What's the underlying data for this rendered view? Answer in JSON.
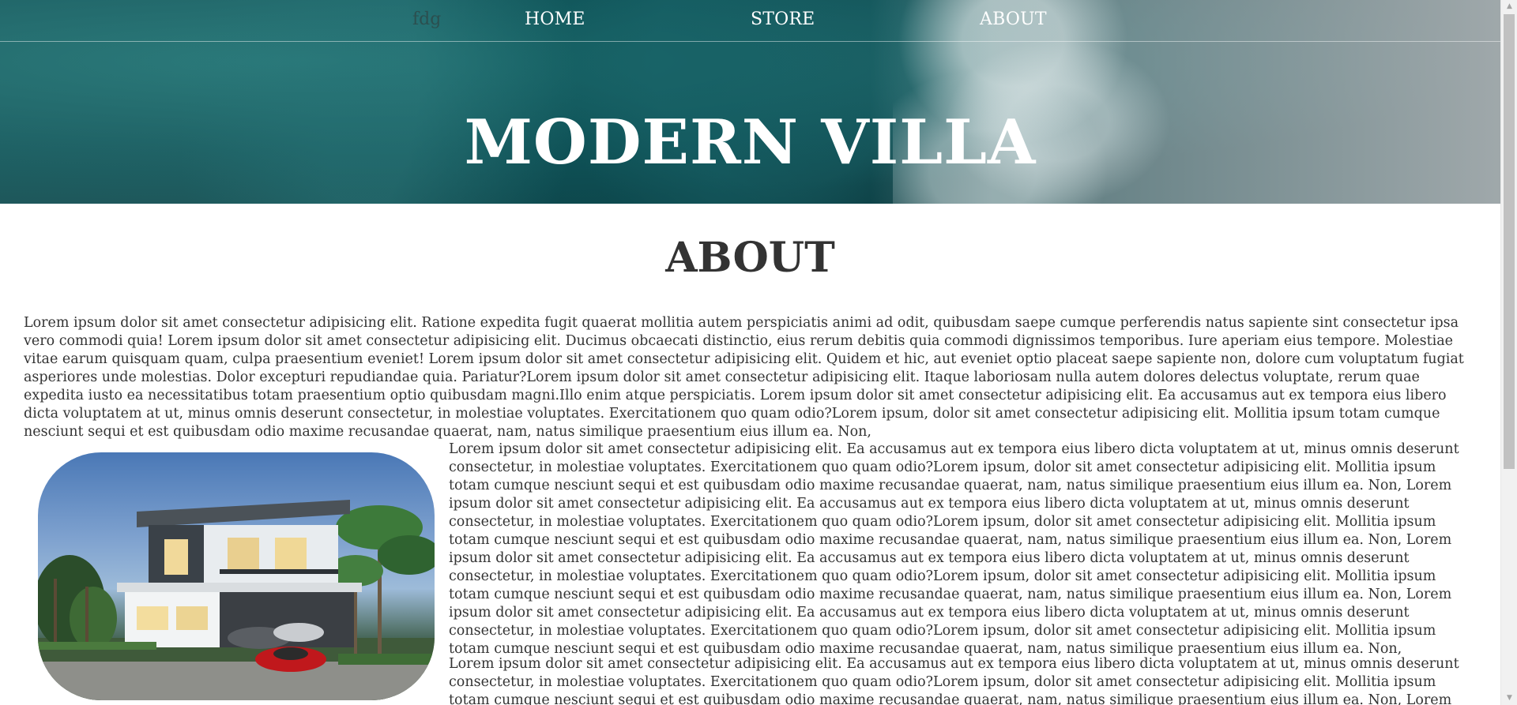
{
  "nav": {
    "brand": "fdg",
    "items": [
      {
        "label": "HOME"
      },
      {
        "label": "STORE"
      },
      {
        "label": "ABOUT"
      }
    ]
  },
  "hero": {
    "title": "MODERN VILLA"
  },
  "about": {
    "heading": "ABOUT",
    "paragraph1": "Lorem ipsum dolor sit amet consectetur adipisicing elit. Ratione expedita fugit quaerat mollitia autem perspiciatis animi ad odit, quibusdam saepe cumque perferendis natus sapiente sint consectetur ipsa vero commodi quia! Lorem ipsum dolor sit amet consectetur adipisicing elit. Ducimus obcaecati distinctio, eius rerum debitis quia commodi dignissimos temporibus. Iure aperiam eius tempore. Molestiae vitae earum quisquam quam, culpa praesentium eveniet! Lorem ipsum dolor sit amet consectetur adipisicing elit. Quidem et hic, aut eveniet optio placeat saepe sapiente non, dolore cum voluptatum fugiat asperiores unde molestias. Dolor excepturi repudiandae quia. Pariatur?Lorem ipsum dolor sit amet consectetur adipisicing elit. Itaque laboriosam nulla autem dolores delectus voluptate, rerum quae expedita iusto ea necessitatibus totam praesentium optio quibusdam magni.Illo enim atque perspiciatis. Lorem ipsum dolor sit amet consectetur adipisicing elit. Ea accusamus aut ex tempora eius libero dicta voluptatem at ut, minus omnis deserunt consectetur, in molestiae voluptates. Exercitationem quo quam odio?Lorem ipsum, dolor sit amet consectetur adipisicing elit. Mollitia ipsum totam cumque nesciunt sequi et est quibusdam odio maxime recusandae quaerat, nam, natus similique praesentium eius illum ea. Non,",
    "paragraph2": "Lorem ipsum dolor sit amet consectetur adipisicing elit. Ea accusamus aut ex tempora eius libero dicta voluptatem at ut, minus omnis deserunt consectetur, in molestiae voluptates. Exercitationem quo quam odio?Lorem ipsum, dolor sit amet consectetur adipisicing elit. Mollitia ipsum totam cumque nesciunt sequi et est quibusdam odio maxime recusandae quaerat, nam, natus similique praesentium eius illum ea. Non, Lorem ipsum dolor sit amet consectetur adipisicing elit. Ea accusamus aut ex tempora eius libero dicta voluptatem at ut, minus omnis deserunt consectetur, in molestiae voluptates. Exercitationem quo quam odio?Lorem ipsum, dolor sit amet consectetur adipisicing elit. Mollitia ipsum totam cumque nesciunt sequi et est quibusdam odio maxime recusandae quaerat, nam, natus similique praesentium eius illum ea. Non, Lorem ipsum dolor sit amet consectetur adipisicing elit. Ea accusamus aut ex tempora eius libero dicta voluptatem at ut, minus omnis deserunt consectetur, in molestiae voluptates. Exercitationem quo quam odio?Lorem ipsum, dolor sit amet consectetur adipisicing elit. Mollitia ipsum totam cumque nesciunt sequi et est quibusdam odio maxime recusandae quaerat, nam, natus similique praesentium eius illum ea. Non, Lorem ipsum dolor sit amet consectetur adipisicing elit. Ea accusamus aut ex tempora eius libero dicta voluptatem at ut, minus omnis deserunt consectetur, in molestiae voluptates. Exercitationem quo quam odio?Lorem ipsum, dolor sit amet consectetur adipisicing elit. Mollitia ipsum totam cumque nesciunt sequi et est quibusdam odio maxime recusandae quaerat, nam, natus similique praesentium eius illum ea. Non,",
    "paragraph3": "Lorem ipsum dolor sit amet consectetur adipisicing elit. Ea accusamus aut ex tempora eius libero dicta voluptatem at ut, minus omnis deserunt consectetur, in molestiae voluptates. Exercitationem quo quam odio?Lorem ipsum, dolor sit amet consectetur adipisicing elit. Mollitia ipsum totam cumque nesciunt sequi et est quibusdam odio maxime recusandae quaerat, nam, natus similique praesentium eius illum ea. Non, Lorem ipsum dolor sit amet consectetur adipisicing elit. Ea"
  },
  "colors": {
    "text": "#333333",
    "nav_text": "#ffffff",
    "hero_water": "#0f4f55",
    "scrollbar_track": "#f1f1f1",
    "scrollbar_thumb": "#c1c1c1"
  },
  "icons": {
    "scroll_up": "scroll-up-arrow-icon",
    "scroll_down": "scroll-down-arrow-icon"
  }
}
